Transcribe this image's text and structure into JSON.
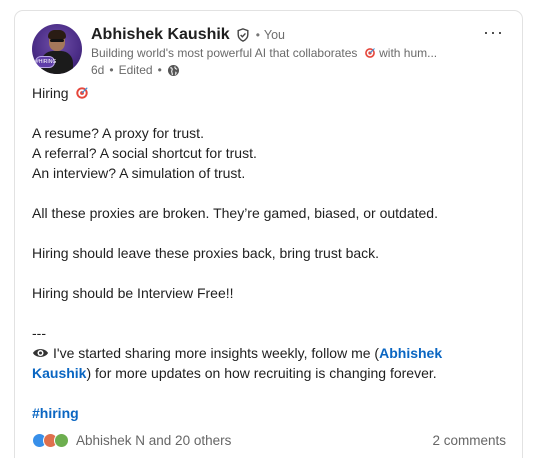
{
  "post": {
    "author": {
      "name": "Abhishek Kaushik",
      "relation": "You",
      "headline": "Building world's most powerful AI that collaborates",
      "headline_suffix": "with hum...",
      "time": "6d",
      "edited": "Edited",
      "avatar_badge": "#HIRING"
    },
    "more_label": "···",
    "body": {
      "line1": "Hiring",
      "line2": "A resume? A proxy for trust.",
      "line3": "A referral? A social shortcut for trust.",
      "line4": "An interview? A simulation of trust.",
      "line5": "All these proxies are broken. They’re gamed, biased, or outdated.",
      "line6": "Hiring should leave these proxies back, bring trust back.",
      "line7": "Hiring should be Interview Free!!",
      "line8": "---",
      "line9_pre": "I've started sharing more insights weekly, follow me (",
      "mention_part1": "Abhishek",
      "mention_part2": "Kaushik",
      "line10_post": ") for more updates on how recruiting is changing forever.",
      "hashtag": "#hiring"
    },
    "social": {
      "reactors": "Abhishek N and 20 others",
      "comments": "2 comments"
    }
  },
  "icons": [
    "verified-icon",
    "globe-icon",
    "target-emoji-icon",
    "eye-speech-icon",
    "like-reaction-icon",
    "love-reaction-icon",
    "support-reaction-icon"
  ],
  "colors": {
    "link": "#0a66c2",
    "text": "#1f1f1f",
    "muted": "#6a6a6a"
  }
}
